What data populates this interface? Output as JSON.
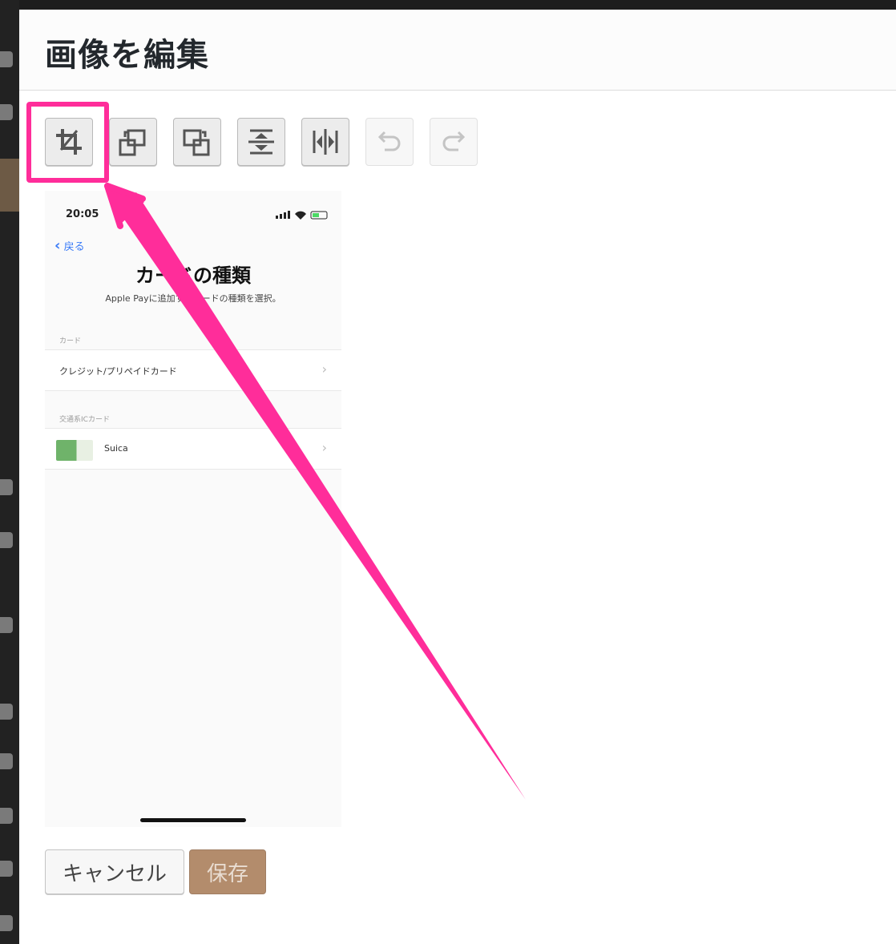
{
  "modal": {
    "title": "画像を編集"
  },
  "toolbar": {
    "buttons": [
      {
        "name": "crop-icon",
        "enabled": true,
        "highlighted": true
      },
      {
        "name": "rotate-left-icon",
        "enabled": true
      },
      {
        "name": "rotate-right-icon",
        "enabled": true
      },
      {
        "name": "flip-vertical-icon",
        "enabled": true
      },
      {
        "name": "flip-horizontal-icon",
        "enabled": true
      },
      {
        "name": "undo-icon",
        "enabled": false
      },
      {
        "name": "redo-icon",
        "enabled": false
      }
    ]
  },
  "preview": {
    "time": "20:05",
    "back": "戻る",
    "title": "カードの種類",
    "subtitle": "Apple Payに追加するカードの種類を選択。",
    "section1": "カード",
    "row1": "クレジット/プリペイドカード",
    "section2": "交通系ICカード",
    "row2": "Suica",
    "chevron": "›"
  },
  "actions": {
    "cancel_label": "キャンセル",
    "save_label": "保存"
  },
  "colors": {
    "highlight": "#ff2d9a",
    "save_button": "#b38c6c",
    "link": "#3a7bf7"
  }
}
